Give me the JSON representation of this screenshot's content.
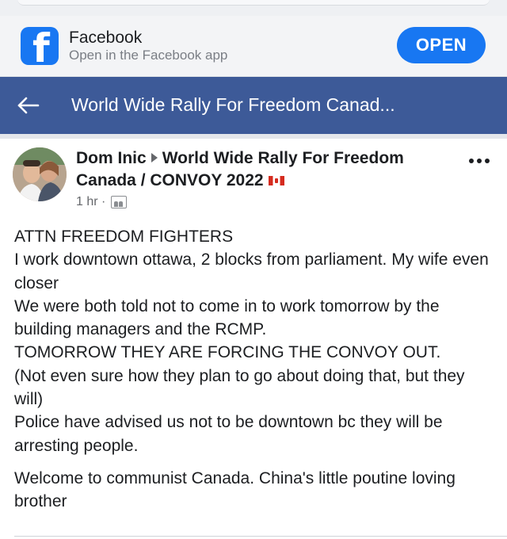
{
  "app_banner": {
    "app_name": "Facebook",
    "subtitle": "Open in the Facebook app",
    "open_label": "OPEN",
    "logo_glyph": "f",
    "brand_color": "#1877f2"
  },
  "group_header": {
    "title": "World Wide Rally For Freedom Canad...",
    "background_color": "#3d5a98",
    "back_icon": "back-arrow-icon"
  },
  "post": {
    "author": "Dom Inic",
    "group_name": "World Wide Rally For Freedom Canada / CONVOY 2022",
    "flag_icon": "canada-flag-icon",
    "timestamp": "1 hr",
    "meta_separator": "·",
    "audience_icon": "group-audience-icon",
    "more_icon": "more-options-icon",
    "lines": [
      "ATTN FREEDOM FIGHTERS",
      "I work downtown ottawa, 2 blocks from parliament. My wife even closer",
      "We were both told not to come in to work tomorrow by the building managers and the RCMP.",
      "TOMORROW THEY ARE FORCING THE CONVOY OUT.",
      "(Not even sure how they plan to go about doing that, but they will)",
      "Police have advised us not to be downtown bc they will be arresting people."
    ],
    "closing": "Welcome to communist Canada. China's little poutine loving brother"
  }
}
